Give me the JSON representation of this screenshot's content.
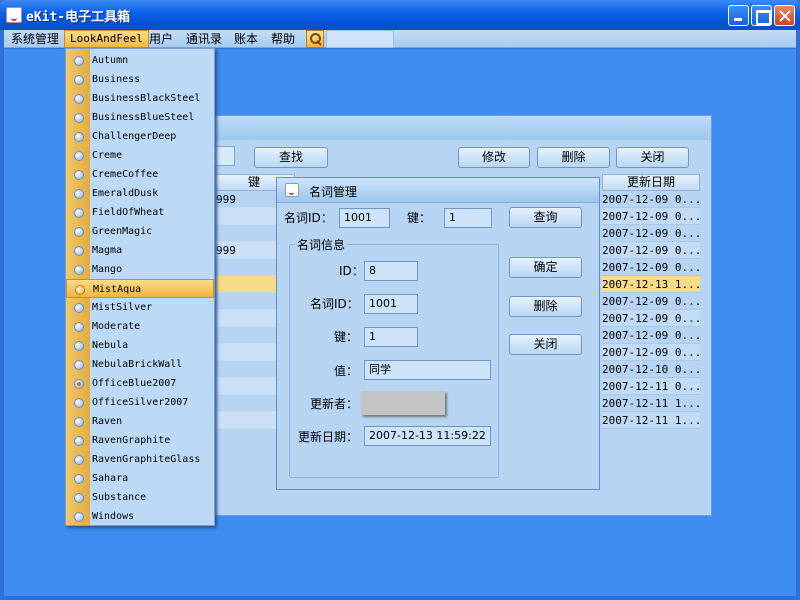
{
  "window": {
    "title": "eKit-电子工具箱"
  },
  "menubar": {
    "items": [
      {
        "label": "系统管理"
      },
      {
        "label": "LookAndFeel"
      },
      {
        "label": "用户"
      },
      {
        "label": "通讯录"
      },
      {
        "label": "账本"
      },
      {
        "label": "帮助"
      }
    ],
    "icon": "search-icon"
  },
  "laf_menu": {
    "selected": "OfficeBlue2007",
    "highlighted": "MistAqua",
    "items": [
      "Autumn",
      "Business",
      "BusinessBlackSteel",
      "BusinessBlueSteel",
      "ChallengerDeep",
      "Creme",
      "CremeCoffee",
      "EmeraldDusk",
      "FieldOfWheat",
      "GreenMagic",
      "Magma",
      "Mango",
      "MistAqua",
      "MistSilver",
      "Moderate",
      "Nebula",
      "NebulaBrickWall",
      "OfficeBlue2007",
      "OfficeSilver2007",
      "Raven",
      "RavenGraphite",
      "RavenGraphiteGlass",
      "Sahara",
      "Substance",
      "Windows"
    ]
  },
  "background_frame": {
    "buttons": {
      "find": "查找",
      "edit": "修改",
      "delete": "删除",
      "close": "关闭"
    },
    "columns": {
      "key": "键",
      "updated": "更新日期"
    },
    "rows": [
      {
        "key": "999"
      },
      {
        "key": ""
      },
      {
        "key": ""
      },
      {
        "key": "999"
      },
      {
        "key": ""
      },
      {
        "key": ""
      },
      {
        "key": ""
      },
      {
        "key": ""
      },
      {
        "key": ""
      },
      {
        "key": ""
      },
      {
        "key": ""
      },
      {
        "key": ""
      },
      {
        "key": ""
      },
      {
        "key": ""
      }
    ],
    "dates": [
      "2007-12-09 0...",
      "2007-12-09 0...",
      "2007-12-09 0...",
      "2007-12-09 0...",
      "2007-12-09 0...",
      "2007-12-13 1...",
      "2007-12-09 0...",
      "2007-12-09 0...",
      "2007-12-09 0...",
      "2007-12-09 0...",
      "2007-12-10 0...",
      "2007-12-11 0...",
      "2007-12-11 1...",
      "2007-12-11 1..."
    ],
    "selected_row": 5
  },
  "dialog": {
    "title": "名词管理",
    "search": {
      "noun_id_label": "名词ID：",
      "noun_id_value": "1001",
      "key_label": "键：",
      "key_value": "1",
      "query_button": "查询"
    },
    "group_title": "名词信息",
    "fields": {
      "id_label": "ID：",
      "id_value": "8",
      "noun_id_label": "名词ID：",
      "noun_id_value": "1001",
      "key_label": "键：",
      "key_value": "1",
      "value_label": "值：",
      "value_value": "同学",
      "updater_label": "更新者：",
      "updated_label": "更新日期：",
      "updated_value": "2007-12-13 11:59:22"
    },
    "buttons": {
      "ok": "确定",
      "delete": "删除",
      "close": "关闭"
    }
  }
}
